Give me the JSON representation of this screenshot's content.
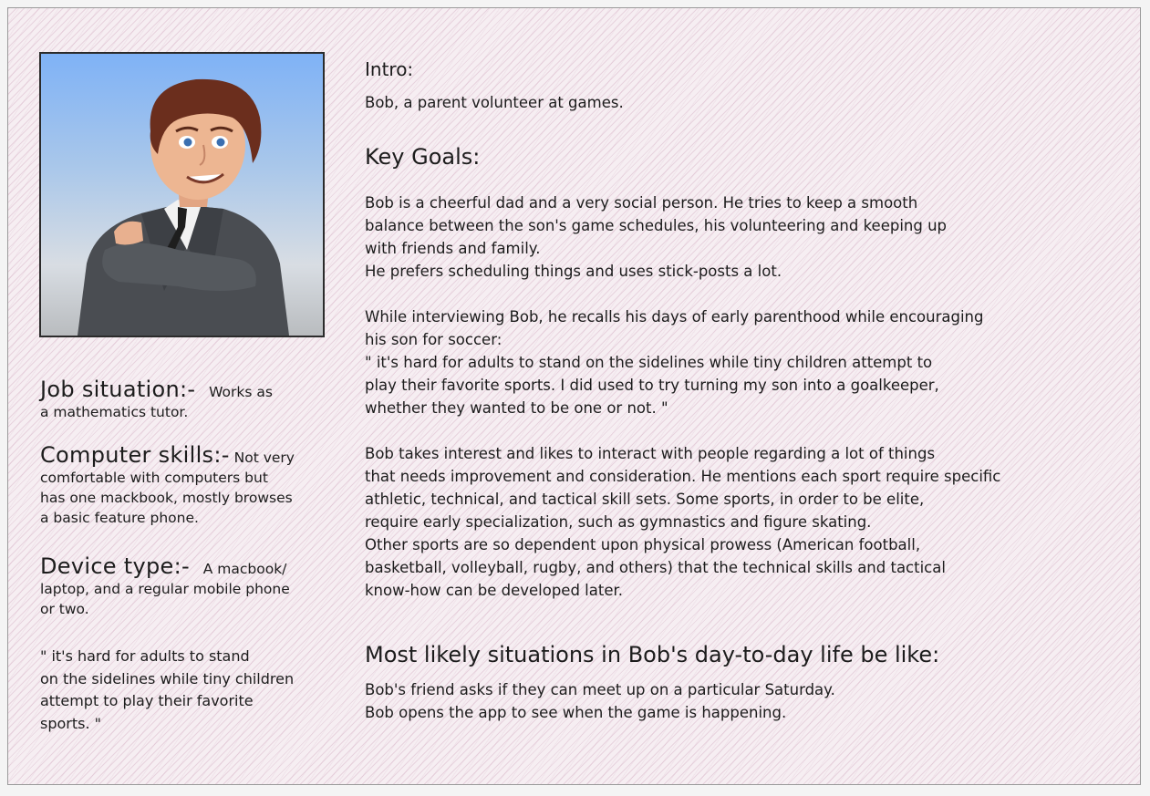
{
  "persona": {
    "photo_icon": "persona-avatar-businessman",
    "job": {
      "label": "Job situation:-",
      "text": "Works as",
      "text2": "a mathematics tutor."
    },
    "computer": {
      "label": "Computer skills:-",
      "text": "Not very",
      "text2": "comfortable with computers but\nhas one mackbook, mostly browses\na basic feature phone."
    },
    "device": {
      "label": "Device type:-",
      "text": "A macbook/",
      "text2": "laptop, and a regular mobile phone\nor two."
    },
    "quote": "\"  it's hard for adults to stand\non the sidelines while tiny children\nattempt to play their favorite\nsports.  \""
  },
  "intro": {
    "heading": "Intro:",
    "text": "Bob, a parent volunteer at games."
  },
  "goals": {
    "heading": "Key Goals:",
    "p1": "Bob is a cheerful dad and a very social person. He tries to keep a smooth\nbalance between the son's game schedules, his volunteering and keeping up\nwith friends and family.\nHe prefers scheduling things and uses stick-posts a lot.",
    "p2": "While interviewing Bob, he recalls his days of early parenthood while encouraging\nhis son for soccer:\n\" it's hard for adults to stand on the sidelines while tiny children attempt to\nplay their favorite sports. I did used to try turning my son into a goalkeeper,\nwhether they wanted to be one or not. \"",
    "p3": "Bob takes interest and likes to interact with people regarding a lot of things\nthat needs improvement and consideration. He mentions each sport require specific\nathletic, technical, and tactical skill sets. Some sports, in order to be elite,\nrequire early specialization, such as gymnastics and figure skating.\nOther sports are so dependent upon physical prowess (American football,\nbasketball, volleyball, rugby, and others) that the technical skills and tactical\nknow-how can be developed later."
  },
  "situations": {
    "heading": "Most likely situations in Bob's day-to-day life be like:",
    "text": "Bob's friend asks if they can meet up on a particular Saturday.\nBob opens the app to see when the game is happening."
  }
}
